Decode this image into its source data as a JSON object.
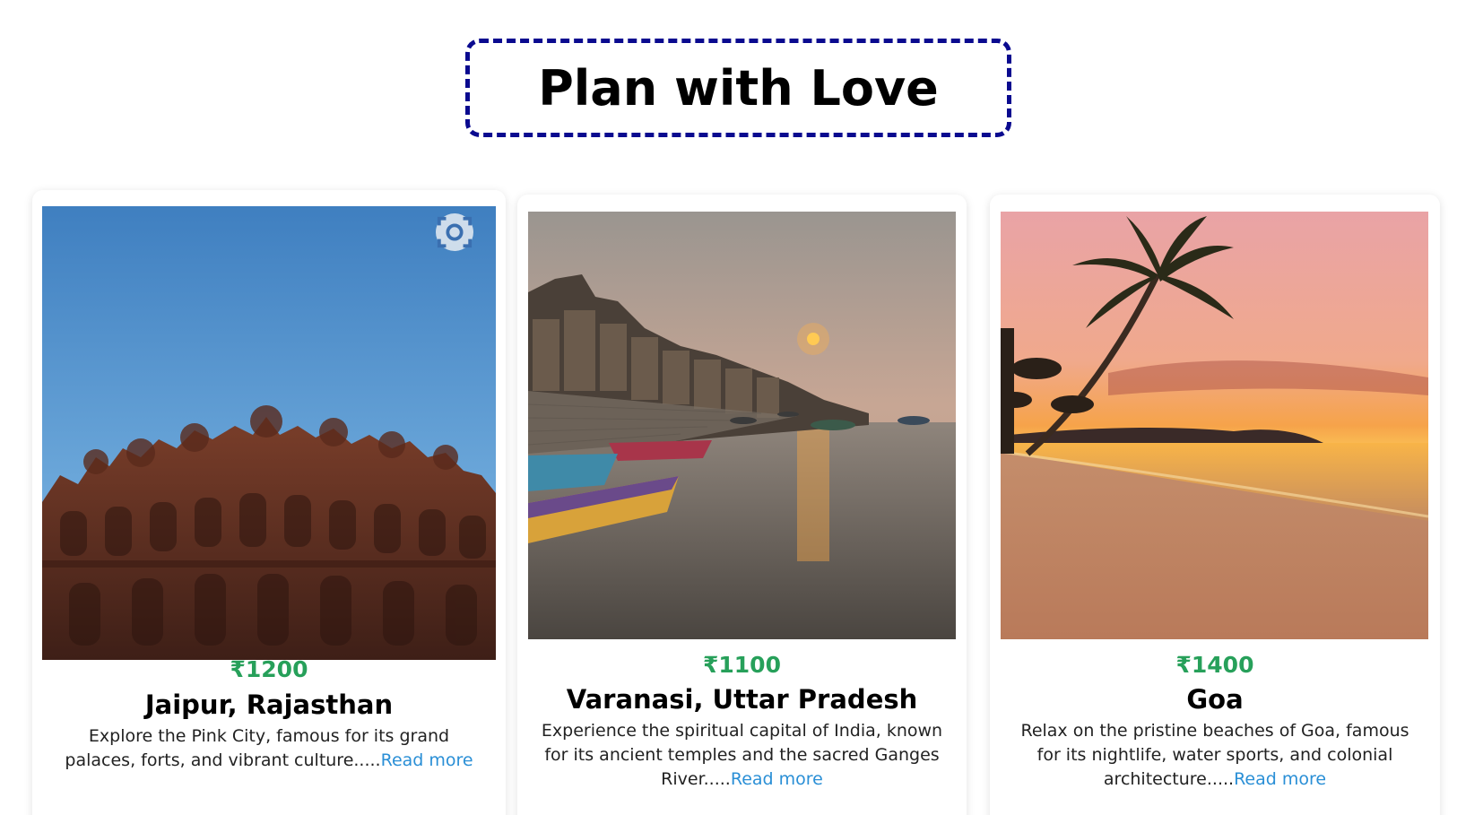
{
  "header": {
    "title": "Plan with Love"
  },
  "cards": [
    {
      "price": "₹1200",
      "name": "Jaipur, Rajasthan",
      "description": "Explore the Pink City, famous for its grand palaces, forts, and vibrant culture.....",
      "read_more": "Read more",
      "image_icon": "hawa-mahal-image"
    },
    {
      "price": "₹1100",
      "name": "Varanasi, Uttar Pradesh",
      "description": "Experience the spiritual capital of India, known for its ancient temples and the sacred Ganges River.....",
      "read_more": "Read more",
      "image_icon": "varanasi-ghats-image"
    },
    {
      "price": "₹1400",
      "name": "Goa",
      "description": "Relax on the pristine beaches of Goa, famous for its nightlife, water sports, and colonial architecture.....",
      "read_more": "Read more",
      "image_icon": "goa-beach-image"
    }
  ],
  "colors": {
    "title_border": "#0a0a8f",
    "price": "#27a05a",
    "link": "#2a8fd6"
  }
}
